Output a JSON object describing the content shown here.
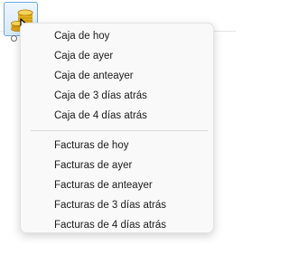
{
  "toolbar": {
    "app_icon": "coins-icon",
    "cursor_icon": "arrow-cursor-icon"
  },
  "menu": {
    "groups": [
      {
        "items": [
          {
            "label": "Caja de hoy"
          },
          {
            "label": "Caja de ayer"
          },
          {
            "label": "Caja de anteayer"
          },
          {
            "label": "Caja de 3 días atrás"
          },
          {
            "label": "Caja de 4 días atrás"
          }
        ]
      },
      {
        "items": [
          {
            "label": "Facturas de hoy"
          },
          {
            "label": "Facturas de ayer"
          },
          {
            "label": "Facturas de anteayer"
          },
          {
            "label": "Facturas de 3 días atrás"
          },
          {
            "label": "Facturas de 4 días atrás"
          }
        ]
      }
    ]
  }
}
